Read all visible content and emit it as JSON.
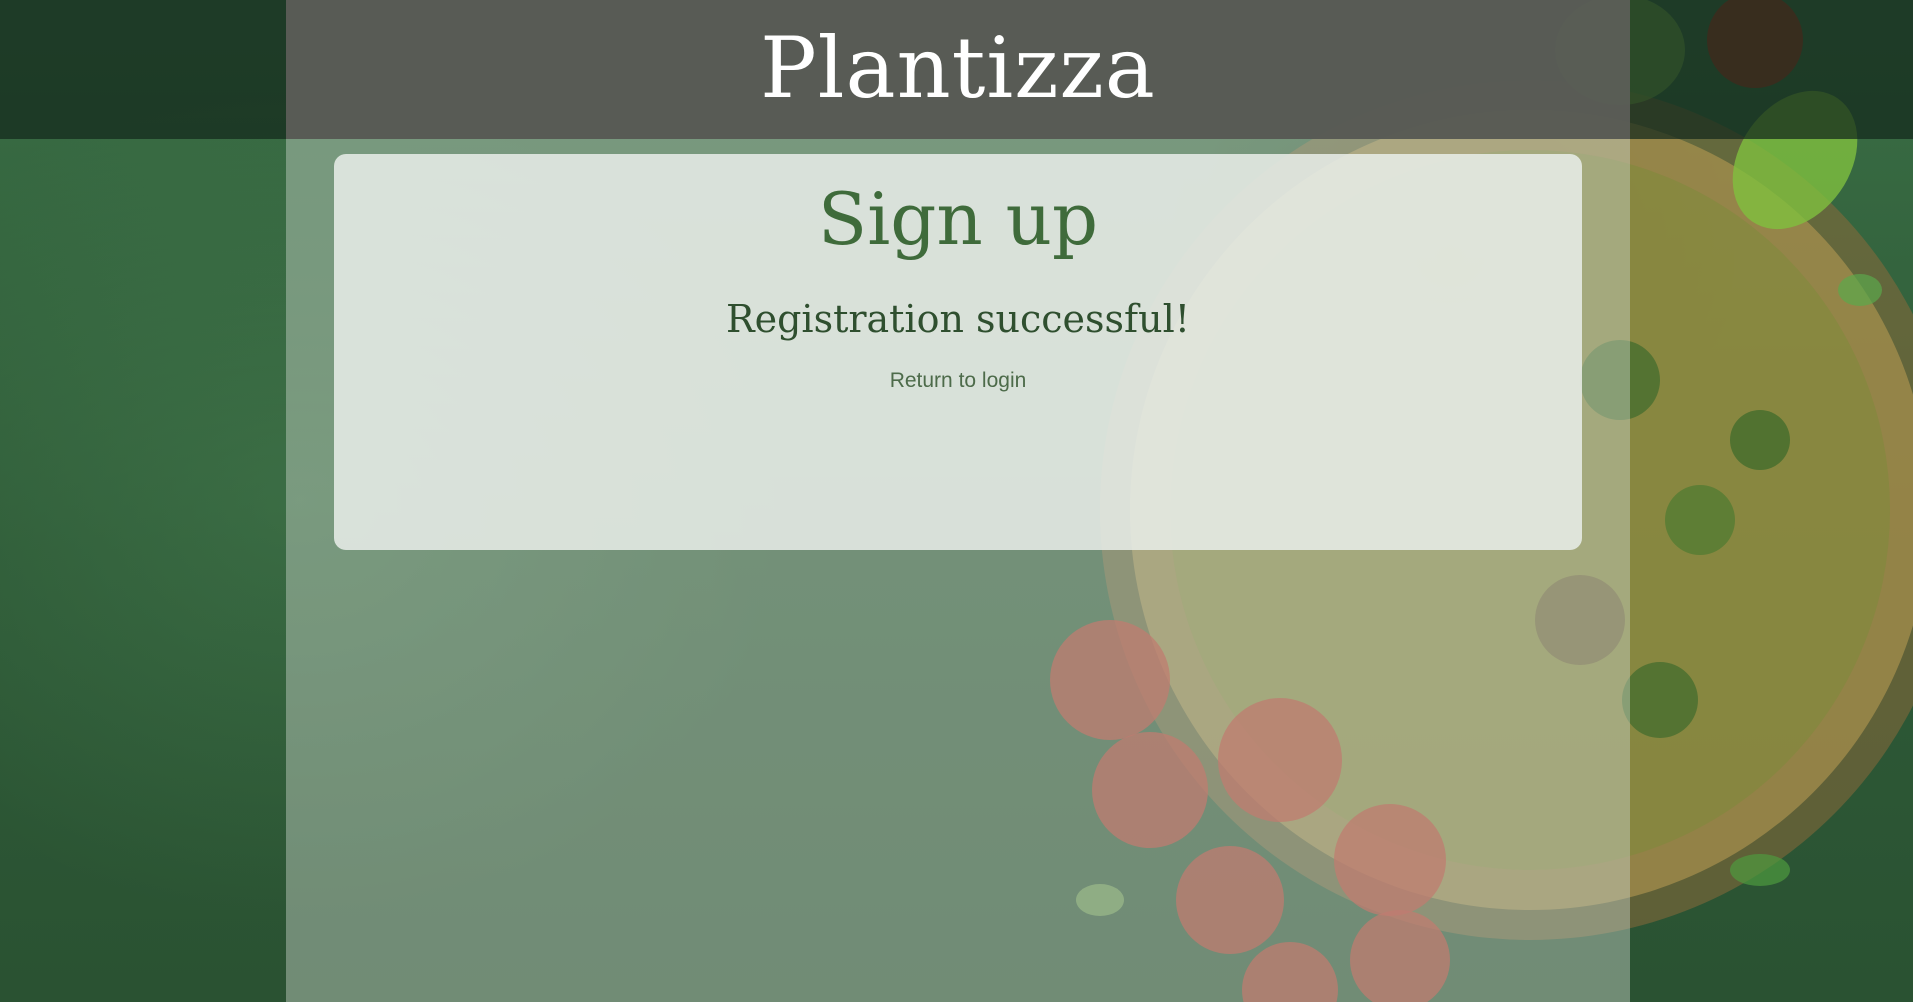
{
  "app": {
    "brand": "Plantizza"
  },
  "card": {
    "title": "Sign up",
    "message": "Registration successful!",
    "return_link": "Return to login"
  },
  "colors": {
    "brand_green": "#3f6b3b",
    "background_green": "#2f5a38",
    "text_dark_green": "#2f4f2f",
    "link_green": "#4d6b4a"
  }
}
